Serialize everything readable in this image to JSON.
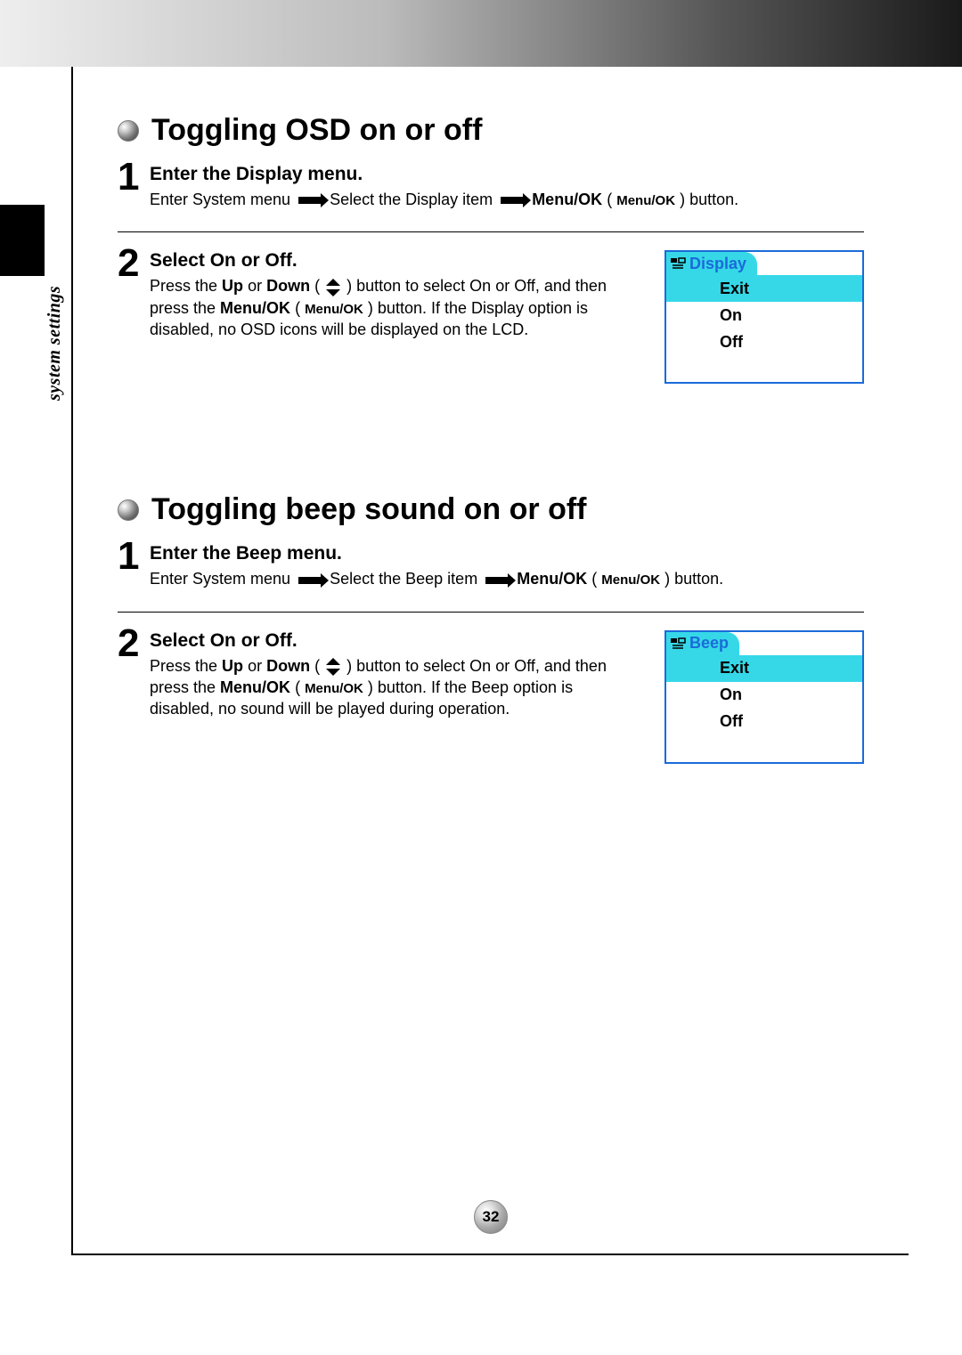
{
  "page_number": "32",
  "side_label": "system settings",
  "section1": {
    "title": "Toggling OSD on or off",
    "step1": {
      "num": "1",
      "heading": "Enter the Display menu.",
      "pre1": "Enter System menu ",
      "mid1": " Select the Display item ",
      "bold1": "Menu/OK",
      "paren_open": " ( ",
      "btn_label": "Menu/OK",
      "paren_close": " ) ",
      "post": "button."
    },
    "step2": {
      "num": "2",
      "heading": "Select On or Off.",
      "line1a": "Press the ",
      "up_bold": "Up",
      "line1b": " or ",
      "down_bold": "Down",
      "line1c": " ( ",
      "line1d": " ) button to select On or Off, and then press the ",
      "menuok_bold": "Menu/OK",
      "line2a": "( ",
      "btn_label": "Menu/OK",
      "line2b": " ) button. If the Display option is disabled, no OSD icons will be displayed on the LCD."
    },
    "menu": {
      "tab": "Display",
      "items": [
        "Exit",
        "On",
        "Off"
      ]
    }
  },
  "section2": {
    "title": "Toggling beep sound on or off",
    "step1": {
      "num": "1",
      "heading": "Enter the Beep menu.",
      "pre1": "Enter System menu ",
      "mid1": " Select the Beep item ",
      "bold1": "Menu/OK",
      "paren_open": " ( ",
      "btn_label": "Menu/OK",
      "paren_close": " ) ",
      "post": "button."
    },
    "step2": {
      "num": "2",
      "heading": "Select On or Off.",
      "line1a": "Press the ",
      "up_bold": "Up",
      "line1b": " or ",
      "down_bold": "Down",
      "line1c": " ( ",
      "line1d": " ) button to select On or Off, and then press the ",
      "menuok_bold": "Menu/OK",
      "line2a": "( ",
      "btn_label": "Menu/OK",
      "line2b": " ) button. If the Beep option is disabled, no sound will be played during operation."
    },
    "menu": {
      "tab": "Beep",
      "items": [
        "Exit",
        "On",
        "Off"
      ]
    }
  }
}
